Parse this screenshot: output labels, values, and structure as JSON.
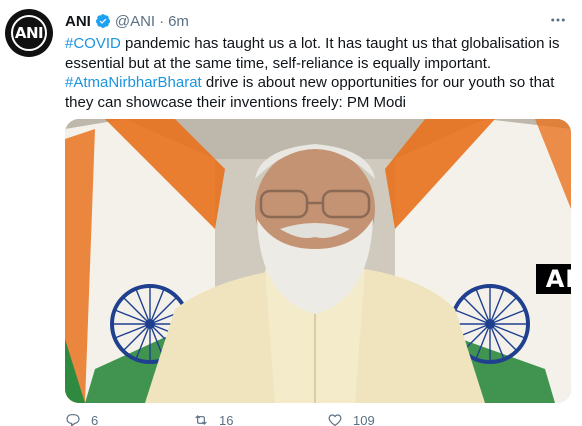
{
  "tweet": {
    "name": "ANI",
    "handle": "@ANI",
    "separator": "·",
    "time": "6m",
    "text": {
      "tag1": "#COVID",
      "part1": " pandemic has taught us a lot. It has taught us that globalisation is essential but at the same time, self-reliance is equally important.",
      "tag2": "#AtmaNirbharBharat",
      "part2": " drive is about new opportunities for our youth so that they can showcase their inventions freely: PM Modi"
    },
    "media": {
      "watermark": "ANI"
    },
    "avatar_text": "ANI",
    "actions": {
      "reply_count": "6",
      "retweet_count": "16",
      "like_count": "109"
    }
  },
  "colors": {
    "link": "#1b95e0",
    "verified": "#1da1f2",
    "secondary_text": "#5b7083",
    "saffron": "#e8731f",
    "green": "#2d8a3e"
  },
  "icons": [
    "verified-badge-icon",
    "more-options-icon",
    "reply-icon",
    "retweet-icon",
    "like-icon"
  ]
}
